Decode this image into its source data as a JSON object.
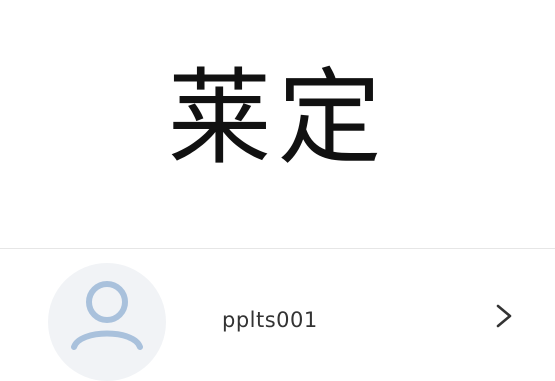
{
  "header": {
    "title": "莱定"
  },
  "account": {
    "username": "pplts001",
    "avatar_icon": "user-avatar-icon",
    "chevron_icon": "chevron-right-icon",
    "accent_color": "#a9c1dc"
  }
}
